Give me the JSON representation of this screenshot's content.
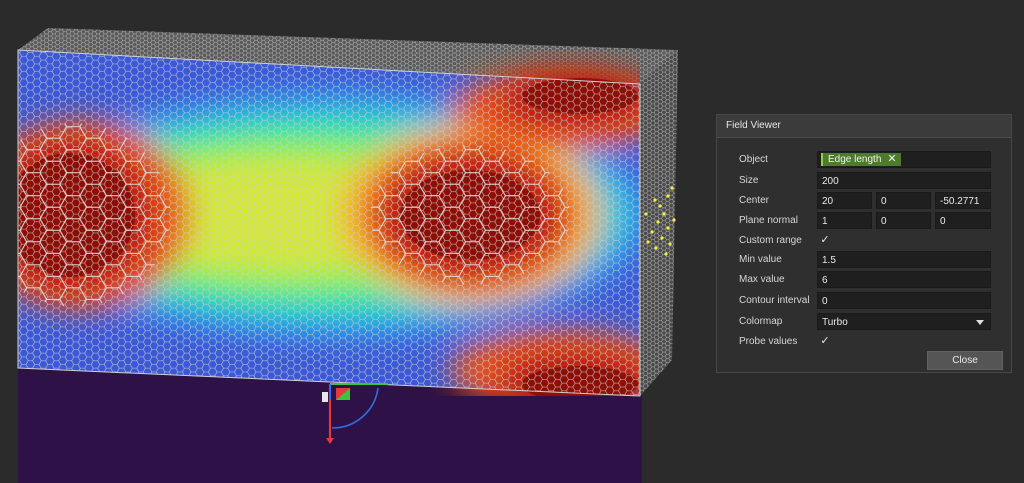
{
  "viewport": {
    "colormap_stops": [
      "#3b58d6",
      "#2f8ef0",
      "#21c9d8",
      "#2ee89a",
      "#7ff24a",
      "#d3e838",
      "#f6b12e",
      "#e8531f",
      "#b1180d",
      "#7a0a04"
    ],
    "mesh_line_color": "#c8c8c8",
    "background": "#2b2b2b",
    "ground_color": "#2d1147"
  },
  "panel": {
    "title": "Field Viewer",
    "object_label": "Object",
    "object_chip": "Edge length",
    "object_chip_close": "✕",
    "size_label": "Size",
    "size_value": "200",
    "center_label": "Center",
    "center_x": "20",
    "center_y": "0",
    "center_z": "-50.2771",
    "plane_normal_label": "Plane normal",
    "normal_x": "1",
    "normal_y": "0",
    "normal_z": "0",
    "custom_range_label": "Custom range",
    "custom_range_checked": "✓",
    "min_label": "Min value",
    "min_value": "1.5",
    "max_label": "Max value",
    "max_value": "6",
    "contour_label": "Contour interval",
    "contour_value": "0",
    "colormap_label": "Colormap",
    "colormap_value": "Turbo",
    "probe_label": "Probe values",
    "probe_checked": "✓",
    "close_label": "Close"
  }
}
